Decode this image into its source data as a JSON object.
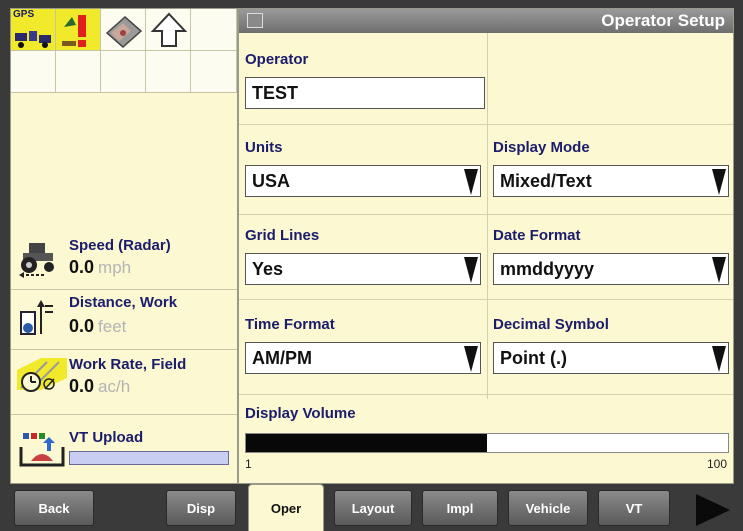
{
  "status_icons": {
    "gps_label": "GPS",
    "icons": [
      "gps-receiver-icon",
      "warning-icon",
      "eraser-icon",
      "up-arrow-icon"
    ]
  },
  "readouts": [
    {
      "label": "Speed (Radar)",
      "value": "0.0",
      "unit": "mph",
      "icon": "tractor-icon"
    },
    {
      "label": "Distance, Work",
      "value": "0.0",
      "unit": "feet",
      "icon": "distance-icon"
    },
    {
      "label": "Work Rate, Field",
      "value": "0.0",
      "unit": "ac/h",
      "icon": "work-rate-icon"
    },
    {
      "label": "VT Upload",
      "value": "",
      "unit": "",
      "icon": "vt-upload-icon"
    }
  ],
  "main": {
    "title": "Operator Setup",
    "operator": {
      "label": "Operator",
      "value": "TEST"
    },
    "units": {
      "label": "Units",
      "value": "USA"
    },
    "display_mode": {
      "label": "Display Mode",
      "value": "Mixed/Text"
    },
    "grid_lines": {
      "label": "Grid Lines",
      "value": "Yes"
    },
    "date_format": {
      "label": "Date Format",
      "value": "mmddyyyy"
    },
    "time_format": {
      "label": "Time Format",
      "value": "AM/PM"
    },
    "decimal_symbol": {
      "label": "Decimal Symbol",
      "value": "Point (.)"
    },
    "display_volume": {
      "label": "Display Volume",
      "min": "1",
      "max": "100",
      "level_percent": 50
    }
  },
  "tabs": {
    "back": "Back",
    "disp": "Disp",
    "oper": "Oper",
    "layout": "Layout",
    "impl": "Impl",
    "vehicle": "Vehicle",
    "vt": "VT"
  },
  "colors": {
    "panel": "#fbf8d2",
    "label_blue": "#1c1c6c",
    "highlight_yellow": "#f1ea2a",
    "tab_gray": "#6e6e6e"
  }
}
